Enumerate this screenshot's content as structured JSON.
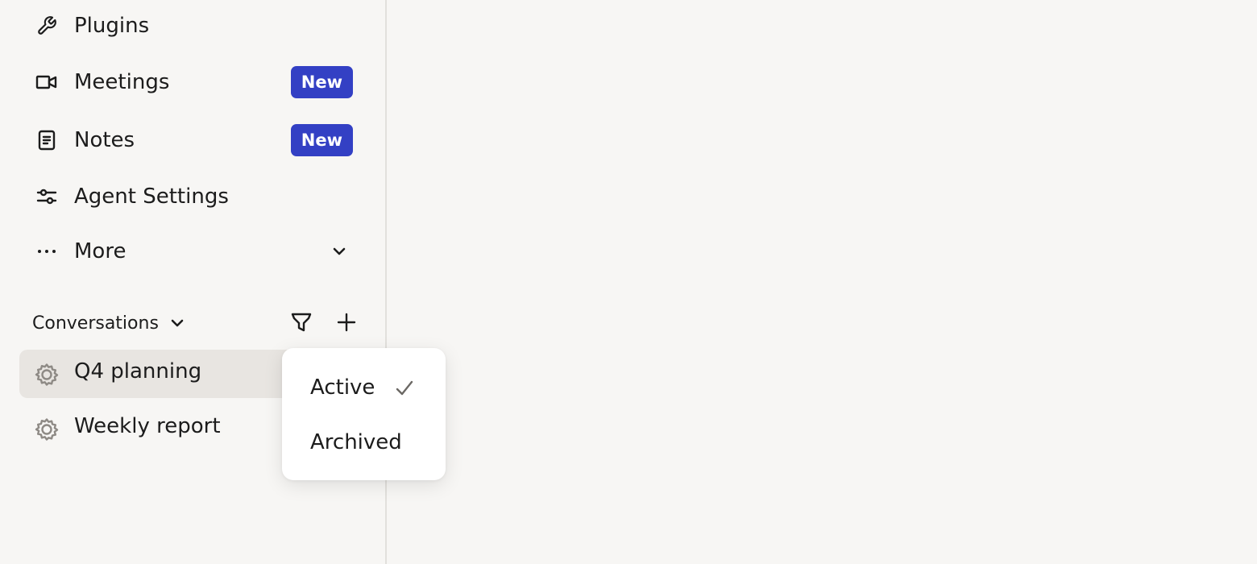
{
  "sidebar": {
    "nav_items": [
      {
        "label": "Plugins",
        "icon": "wrench-icon"
      },
      {
        "label": "Meetings",
        "icon": "video-camera-icon",
        "badge": "New"
      },
      {
        "label": "Notes",
        "icon": "notes-icon",
        "badge": "New"
      },
      {
        "label": "Agent Settings",
        "icon": "sliders-icon"
      },
      {
        "label": "More",
        "icon": "ellipsis-icon"
      }
    ],
    "conversations": {
      "title": "Conversations",
      "items": [
        {
          "label": "Q4 planning",
          "icon": "gear-icon",
          "selected": true
        },
        {
          "label": "Weekly report",
          "icon": "gear-icon",
          "selected": false
        }
      ]
    }
  },
  "filter_menu": {
    "options": [
      {
        "label": "Active",
        "checked": true
      },
      {
        "label": "Archived",
        "checked": false
      }
    ]
  },
  "colors": {
    "badge": "#3340c4",
    "background": "#f7f6f4",
    "selected_row": "#e8e5e1"
  }
}
